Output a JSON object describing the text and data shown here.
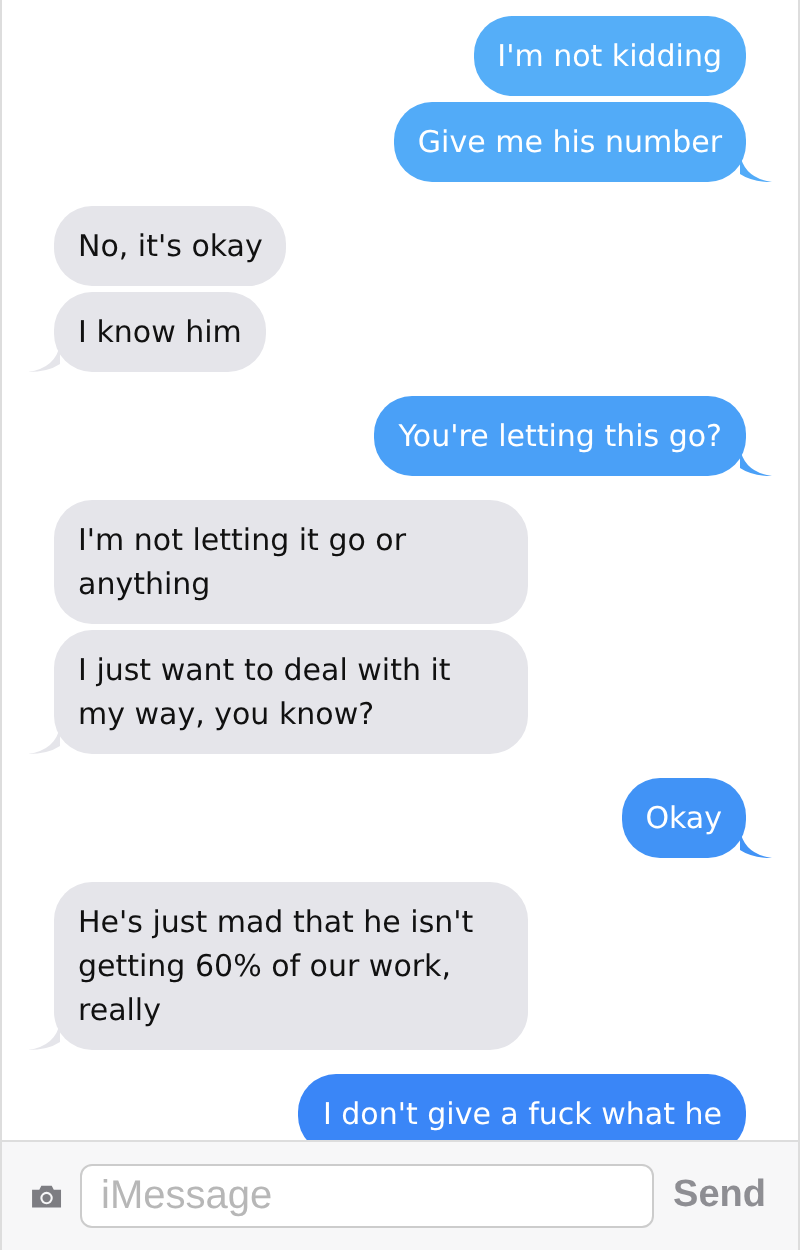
{
  "messages": [
    {
      "kind": "sent",
      "text": "I'm not kidding",
      "tail": false,
      "color": "#55aef8"
    },
    {
      "kind": "sent",
      "text": "Give me his number",
      "tail": true,
      "color": "#52abf8"
    },
    {
      "kind": "received",
      "text": "No, it's okay",
      "tail": false
    },
    {
      "kind": "received",
      "text": "I know him",
      "tail": true
    },
    {
      "kind": "sent",
      "text": "You're letting this go?",
      "tail": true,
      "color": "#4aa0f7"
    },
    {
      "kind": "received",
      "text": "I'm not letting it go or anything",
      "tail": false
    },
    {
      "kind": "received",
      "text": "I just want to deal with it my way, you know?",
      "tail": true
    },
    {
      "kind": "sent",
      "text": "Okay",
      "tail": true,
      "color": "#4193f6"
    },
    {
      "kind": "received",
      "text": "He's just mad that he isn't getting 60% of our work, really",
      "tail": true
    },
    {
      "kind": "sent",
      "text": "I don't give a fuck what he",
      "tail": false,
      "color": "#3a86f7"
    }
  ],
  "composer": {
    "placeholder": "iMessage",
    "send": "Send"
  }
}
